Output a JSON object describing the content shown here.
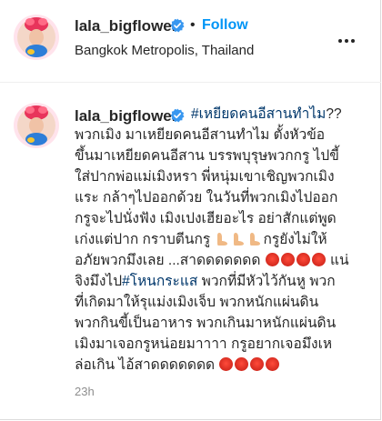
{
  "header": {
    "username": "lala_bigflower",
    "separator": "•",
    "follow_label": "Follow",
    "location": "Bangkok Metropolis, Thailand",
    "more_icon": "more-horizontal-icon"
  },
  "post": {
    "username": "lala_bigflower",
    "lines": [
      {
        "hashtag": "#เหยียดคนอีสานทำไม",
        "text": "??"
      },
      {
        "text": "พวกเมิง มาเหยียดคนอีสานทำไม ตั้งหัวข้อ"
      },
      {
        "text": "ขึ้นมาเหยียดคนอีสาน บรรพบุรุษพวกกรู ไปขี้"
      },
      {
        "text": "ใส่ปากพ่อแม่เมิงหรา พี่หนุ่มเขาเชิญพวกเมิง"
      },
      {
        "text": "แระ กล้าๆไปออกด้วย ในวันที่พวกเมิงไปออก"
      },
      {
        "text": "กรูจะไปนั่งฟัง เมิงเปงเฮียอะไร อย่าสักแต่พูด"
      },
      {
        "pre": "เก่งแต่ปาก กราบตีนกรู ",
        "post": "กรูยังไม่ให้"
      },
      {
        "pre": "อภัยพวกมึงเลย ...สาดดดดดดด ",
        "post": " แน่"
      },
      {
        "pre": "จิงมึงไป",
        "hashtag": "#โหนกระแส",
        "post": " พวกที่มีหัวไว้กันหู พวก"
      },
      {
        "text": "ที่เกิดมาให้รุแม่งเมิงเจ็บ พวกหนักแผ่นดิน"
      },
      {
        "text": "พวกกินขี้เป็นอาหาร พวกเกินมาหนักแผ่นดิน"
      },
      {
        "text": "เมิงมาเจอกรูหน่อยมาาาา กรูอยากเจอมึงเห"
      },
      {
        "pre": "ล่อเกิน ไอ้สาดดดดดดด "
      }
    ],
    "timestamp": "23h"
  },
  "colors": {
    "accent": "#0095f6",
    "hashtag": "#00376b",
    "text": "#262626",
    "muted": "#8e8e8e",
    "verified": "#3897f0"
  },
  "emoji": {
    "feet": "foot-emoji-icon",
    "angry": "angry-face-emoji-icon"
  }
}
